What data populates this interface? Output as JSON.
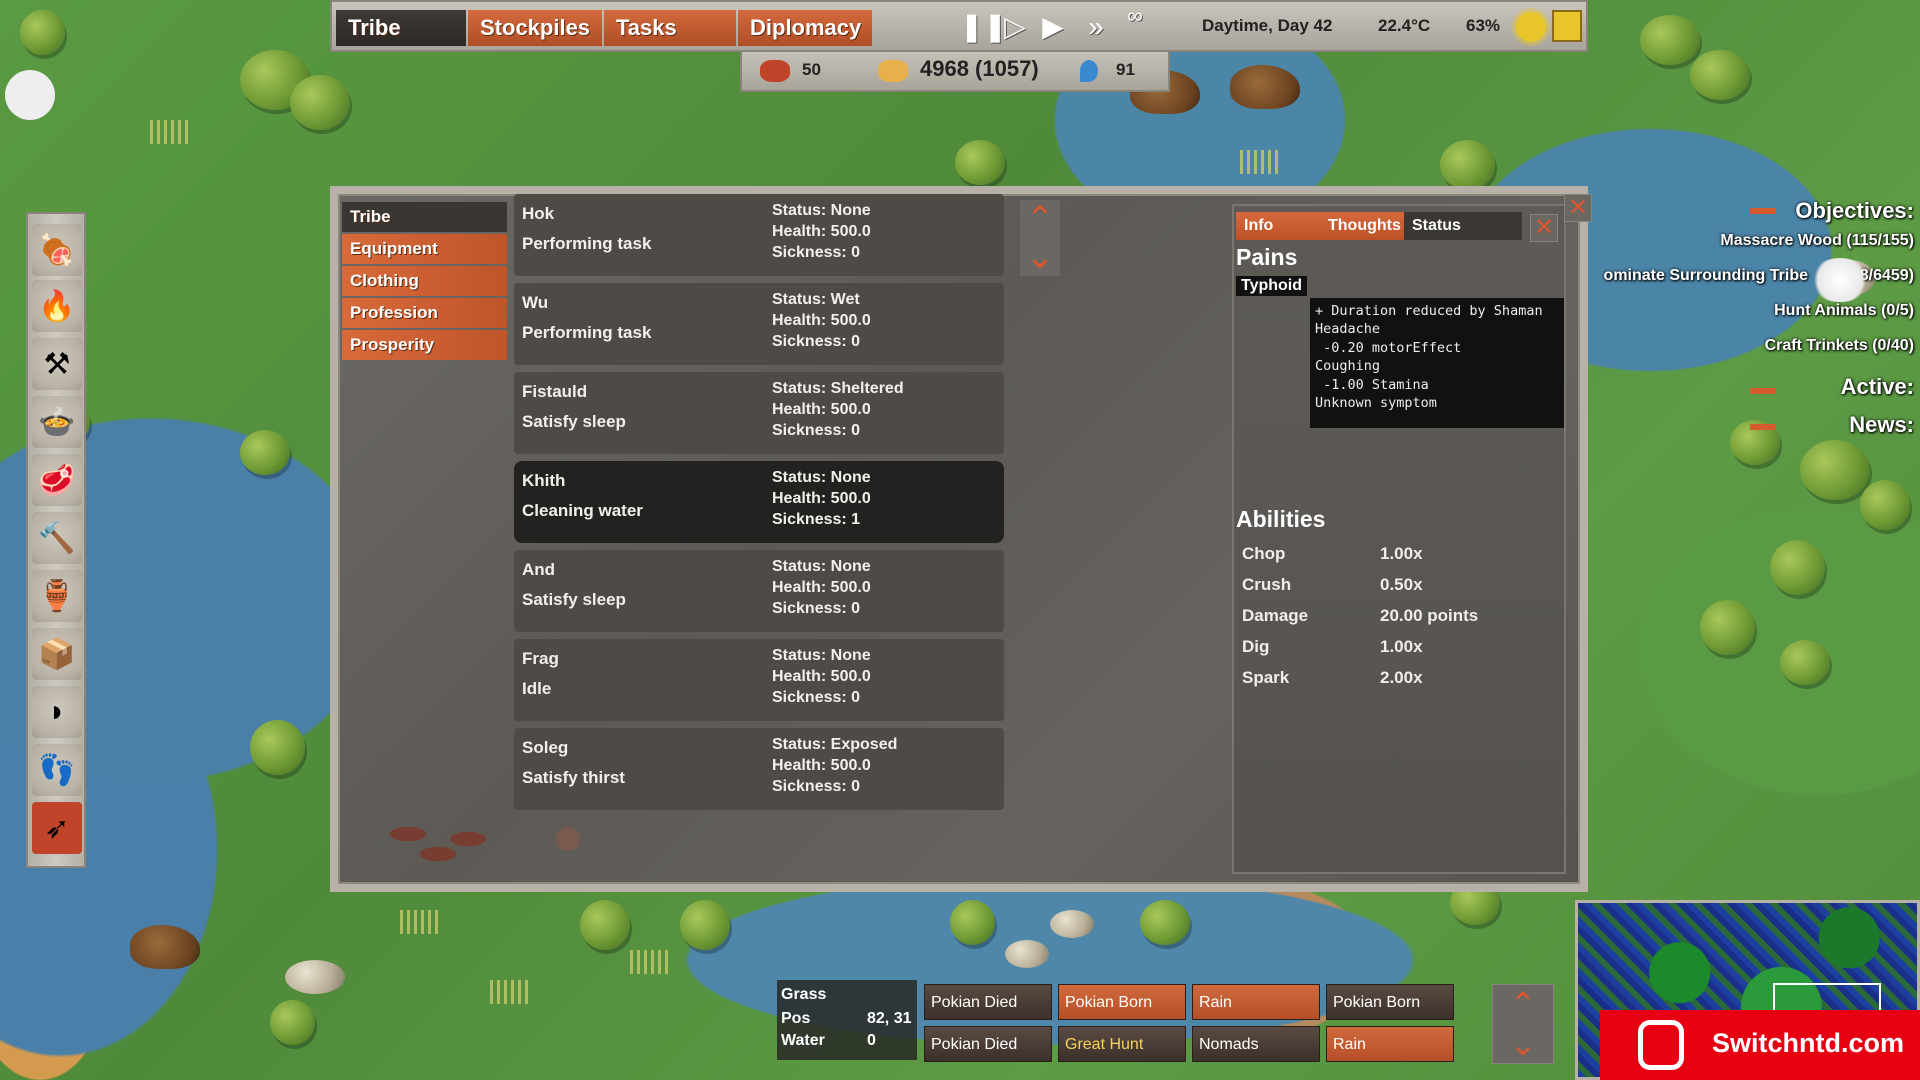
{
  "topbar": {
    "tabs": [
      {
        "label": "Tribe"
      },
      {
        "label": "Stockpiles"
      },
      {
        "label": "Tasks"
      },
      {
        "label": "Diplomacy"
      }
    ],
    "speed": {
      "infinity_glyph": "∞"
    },
    "time": "Daytime, Day 42",
    "temperature": "22.4°C",
    "humidity": "63%"
  },
  "resources": {
    "meat": "50",
    "food": "4968 (1057)",
    "water": "91"
  },
  "left_toolbar": [
    "meat-tray-icon",
    "fire-icon",
    "crossed-axes-icon",
    "food-basket-icon",
    "raw-meat-icon",
    "hammer-icon",
    "jars-icon",
    "crate-icon",
    "bow-icon",
    "footprints-icon",
    "bow-arrow-icon"
  ],
  "side_tabs": [
    {
      "label": "Tribe"
    },
    {
      "label": "Equipment"
    },
    {
      "label": "Clothing"
    },
    {
      "label": "Profession"
    },
    {
      "label": "Prosperity"
    }
  ],
  "members": [
    {
      "name": "Hok",
      "task": "Performing task",
      "status": "Status: None",
      "health": "Health: 500.0",
      "sickness": "Sickness: 0"
    },
    {
      "name": "Wu",
      "task": "Performing task",
      "status": "Status: Wet",
      "health": "Health: 500.0",
      "sickness": "Sickness: 0"
    },
    {
      "name": "Fistauld",
      "task": "Satisfy sleep",
      "status": "Status: Sheltered",
      "health": "Health: 500.0",
      "sickness": "Sickness: 0"
    },
    {
      "name": "Khith",
      "task": "Cleaning water",
      "status": "Status: None",
      "health": "Health: 500.0",
      "sickness": "Sickness: 1"
    },
    {
      "name": "And",
      "task": "Satisfy sleep",
      "status": "Status: None",
      "health": "Health: 500.0",
      "sickness": "Sickness: 0"
    },
    {
      "name": "Frag",
      "task": "Idle",
      "status": "Status: None",
      "health": "Health: 500.0",
      "sickness": "Sickness: 0"
    },
    {
      "name": "Soleg",
      "task": "Satisfy thirst",
      "status": "Status: Exposed",
      "health": "Health: 500.0",
      "sickness": "Sickness: 0"
    }
  ],
  "info_panel": {
    "tabs": [
      {
        "label": "Info"
      },
      {
        "label": "Thoughts"
      },
      {
        "label": "Status"
      }
    ],
    "pains_title": "Pains",
    "pain_item": "Typhoid",
    "tooltip": "+ Duration reduced by Shaman\nHeadache\n -0.20 motorEffect\nCoughing\n -1.00 Stamina\nUnknown symptom",
    "abilities_title": "Abilities",
    "abilities": [
      {
        "name": "Chop",
        "value": "1.00x"
      },
      {
        "name": "Crush",
        "value": "0.50x"
      },
      {
        "name": "Damage",
        "value": "20.00 points"
      },
      {
        "name": "Dig",
        "value": "1.00x"
      },
      {
        "name": "Spark",
        "value": "2.00x"
      }
    ]
  },
  "objectives": {
    "title": "Objectives:",
    "items": [
      "Massacre Wood (115/155)",
      "ominate Surrounding Tribe",
      "8/6459)",
      "Hunt Animals (0/5)",
      "Craft Trinkets (0/40)"
    ],
    "active_label": "Active:",
    "news_label": "News:"
  },
  "tile": {
    "terrain": "Grass",
    "pos_label": "Pos",
    "pos_value": "82, 31",
    "water_label": "Water",
    "water_value": "0"
  },
  "news_feed": [
    {
      "label": "Pokian Died"
    },
    {
      "label": "Pokian Born"
    },
    {
      "label": "Rain"
    },
    {
      "label": "Pokian Born"
    },
    {
      "label": "Pokian Died"
    },
    {
      "label": "Great Hunt"
    },
    {
      "label": "Nomads"
    },
    {
      "label": "Rain"
    }
  ],
  "watermark": "Switchntd.com",
  "colors": {
    "accent": "#c9582b",
    "panel": "#5e5b57",
    "selected_row": "#242220",
    "brand": "#e60012"
  }
}
